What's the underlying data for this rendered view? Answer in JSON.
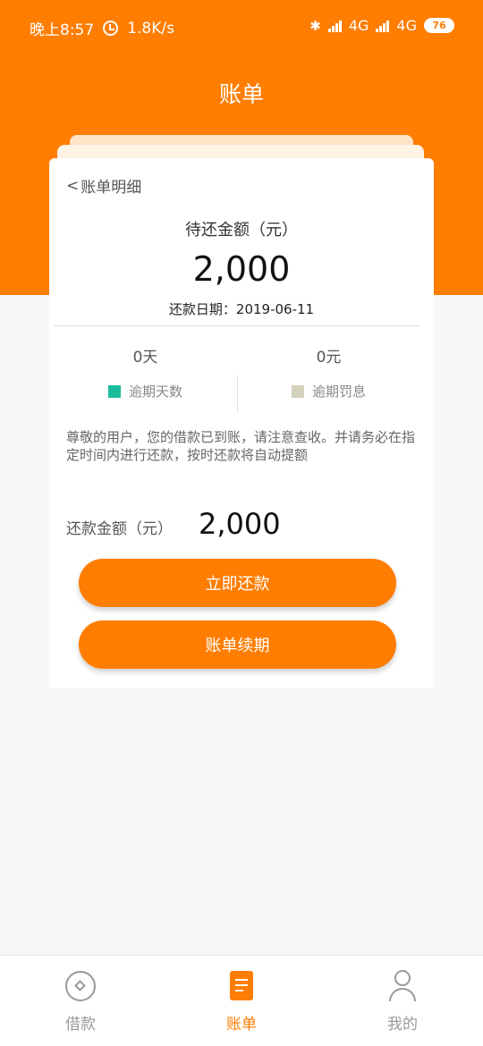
{
  "status_bar": {
    "time": "晚上8:57",
    "speed": "1.8K/s",
    "network1": "4G",
    "network2": "4G",
    "battery": "76"
  },
  "header": {
    "title": "账单"
  },
  "card": {
    "back_label": "账单明细",
    "amount_label": "待还金额（元）",
    "amount_value": "2,000",
    "due_date": "还款日期：2019-06-11",
    "stats": [
      {
        "value": "0天",
        "label": "逾期天数",
        "color": "#1abc9c"
      },
      {
        "value": "0元",
        "label": "逾期罚息",
        "color": "#d4d2bc"
      }
    ],
    "notice": "尊敬的用户，您的借款已到账，请注意查收。并请务必在指定时间内进行还款，按时还款将自动提额",
    "repay_label": "还款金额（元）",
    "repay_value": "2,000",
    "pay_button": "立即还款",
    "renew_button": "账单续期"
  },
  "tabs": [
    {
      "label": "借款",
      "icon": "loan-icon",
      "active": false
    },
    {
      "label": "账单",
      "icon": "bill-icon",
      "active": true
    },
    {
      "label": "我的",
      "icon": "user-icon",
      "active": false
    }
  ],
  "colors": {
    "accent": "#ff7d00",
    "background": "#f7f7f7"
  }
}
